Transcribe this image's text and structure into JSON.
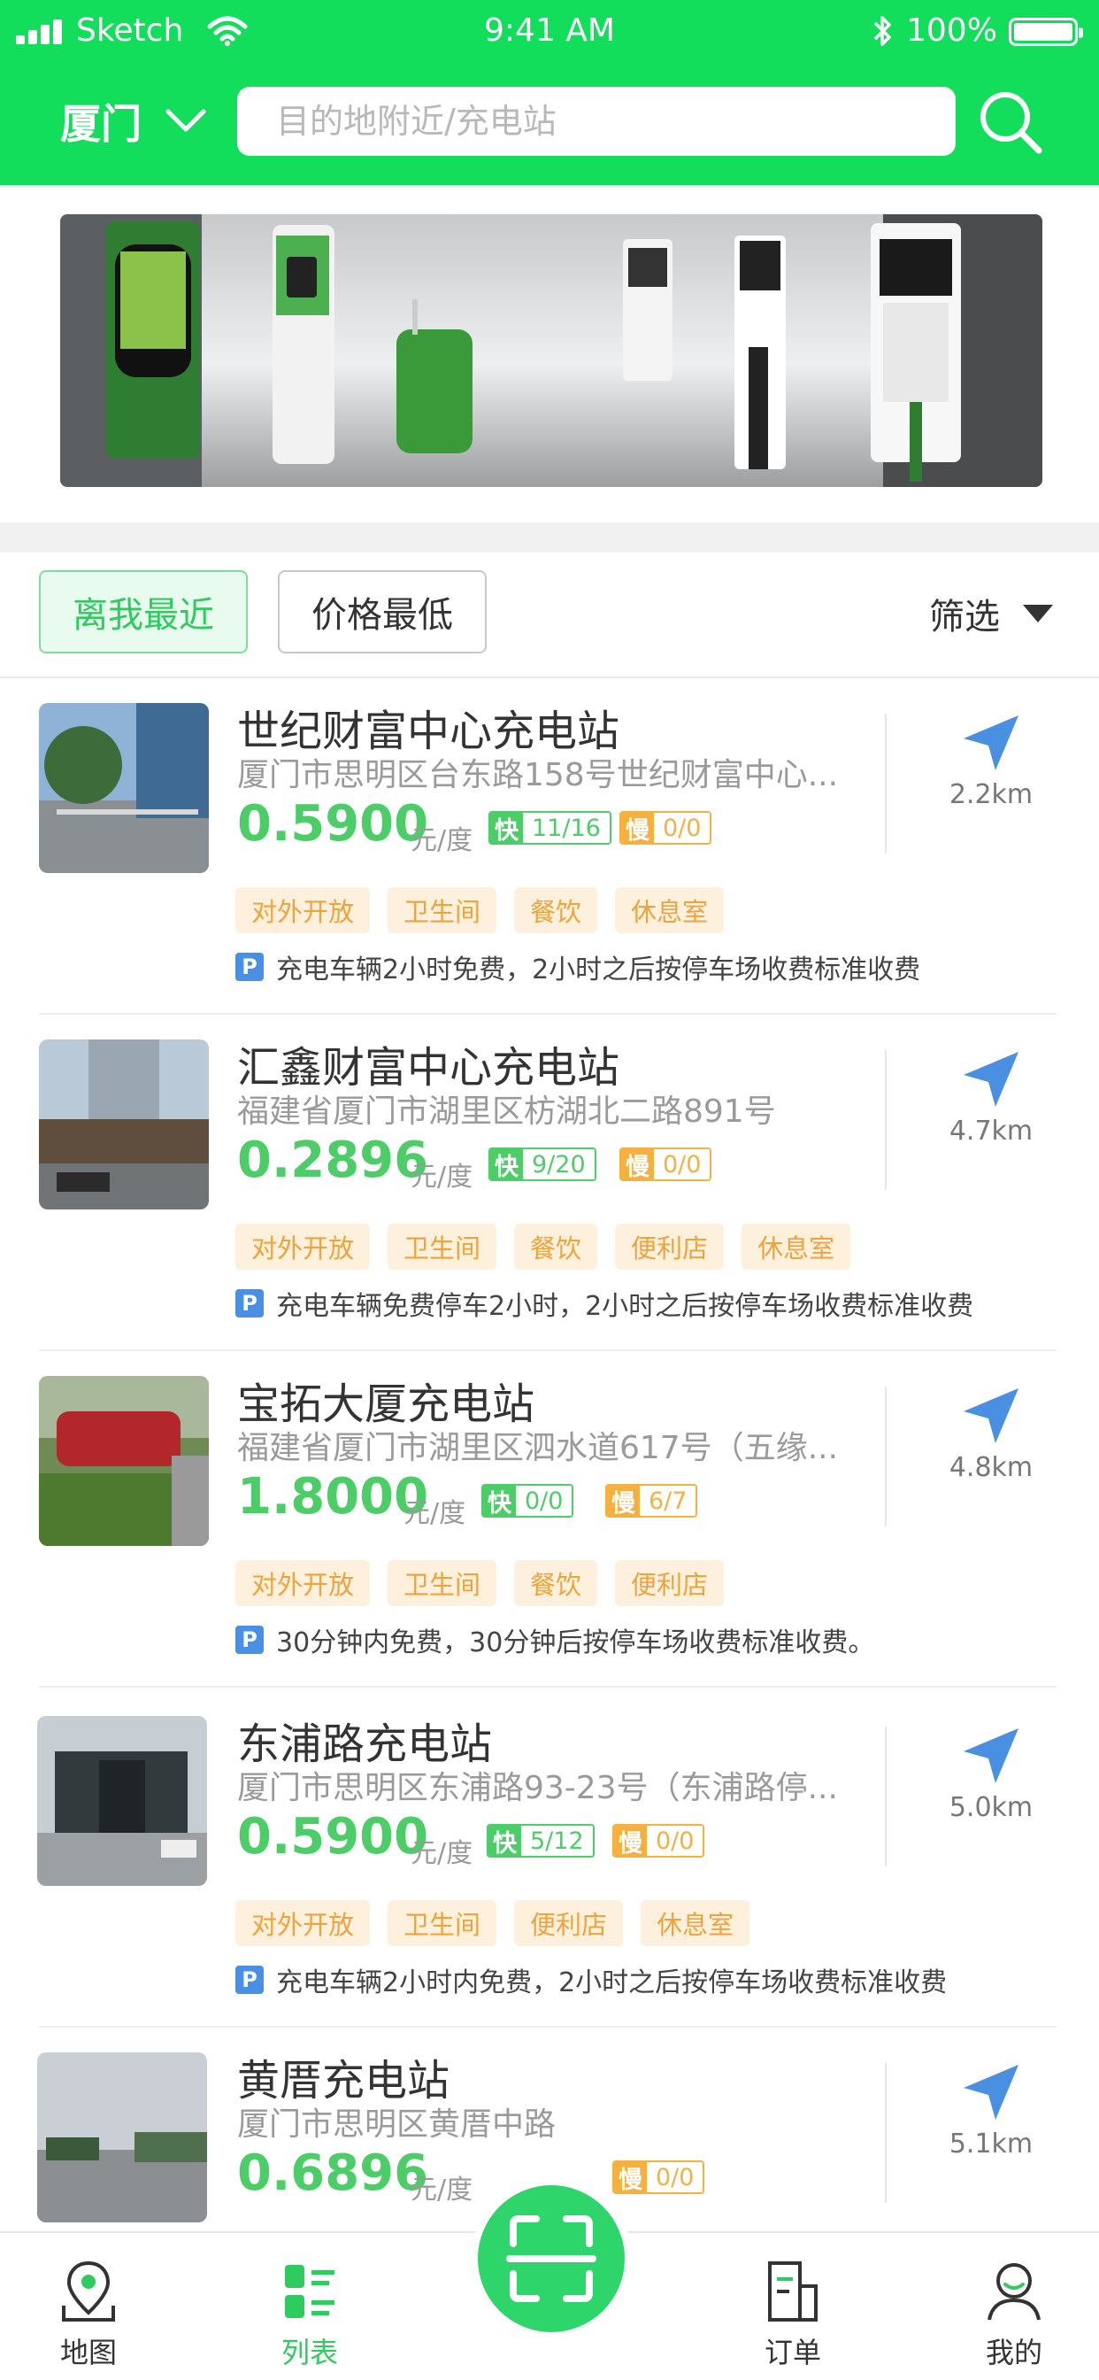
{
  "status_bar": {
    "carrier": "Sketch",
    "time": "9:41 AM",
    "battery": "100%"
  },
  "header": {
    "city": "厦门",
    "search_placeholder": "目的地附近/充电站"
  },
  "sort": {
    "nearest": "离我最近",
    "lowest_price": "价格最低",
    "filter": "筛选"
  },
  "labels": {
    "fast": "快",
    "slow": "慢",
    "unit": "元/度",
    "parking": "P"
  },
  "stations": [
    {
      "name": "世纪财富中心充电站",
      "address": "厦门市思明区台东路158号世纪财富中心...",
      "price": "0.5900",
      "fast": "11/16",
      "slow": "0/0",
      "tags": [
        "对外开放",
        "卫生间",
        "餐饮",
        "休息室"
      ],
      "parking": "充电车辆2小时免费，2小时之后按停车场收费标准收费",
      "distance": "2.2km"
    },
    {
      "name": "汇鑫财富中心充电站",
      "address": "福建省厦门市湖里区枋湖北二路891号",
      "price": "0.2896",
      "fast": "9/20",
      "slow": "0/0",
      "tags": [
        "对外开放",
        "卫生间",
        "餐饮",
        "便利店",
        "休息室"
      ],
      "parking": "充电车辆免费停车2小时，2小时之后按停车场收费标准收费",
      "distance": "4.7km"
    },
    {
      "name": "宝拓大厦充电站",
      "address": "福建省厦门市湖里区泗水道617号（五缘...",
      "price": "1.8000",
      "fast": "0/0",
      "slow": "6/7",
      "tags": [
        "对外开放",
        "卫生间",
        "餐饮",
        "便利店"
      ],
      "parking": "30分钟内免费，30分钟后按停车场收费标准收费。",
      "distance": "4.8km"
    },
    {
      "name": "东浦路充电站",
      "address": "厦门市思明区东浦路93-23号（东浦路停...",
      "price": "0.5900",
      "fast": "5/12",
      "slow": "0/0",
      "tags": [
        "对外开放",
        "卫生间",
        "便利店",
        "休息室"
      ],
      "parking": "充电车辆2小时内免费，2小时之后按停车场收费标准收费",
      "distance": "5.0km"
    },
    {
      "name": "黄厝充电站",
      "address": "厦门市思明区黄厝中路",
      "price": "0.6896",
      "fast": "",
      "slow": "0/0",
      "tags": [],
      "parking": "",
      "distance": "5.1km"
    }
  ],
  "tabbar": {
    "map": "地图",
    "list": "列表",
    "orders": "订单",
    "mine": "我的"
  },
  "colors": {
    "brand_green": "#12DE5C",
    "price_green": "#4ccd67",
    "tag_orange": "#f0a33a",
    "nav_blue": "#4a90e2"
  },
  "icons": {
    "search": "search-icon",
    "chevron": "chevron-down-icon",
    "navigate": "navigate-arrow-icon",
    "scan": "scan-icon"
  }
}
